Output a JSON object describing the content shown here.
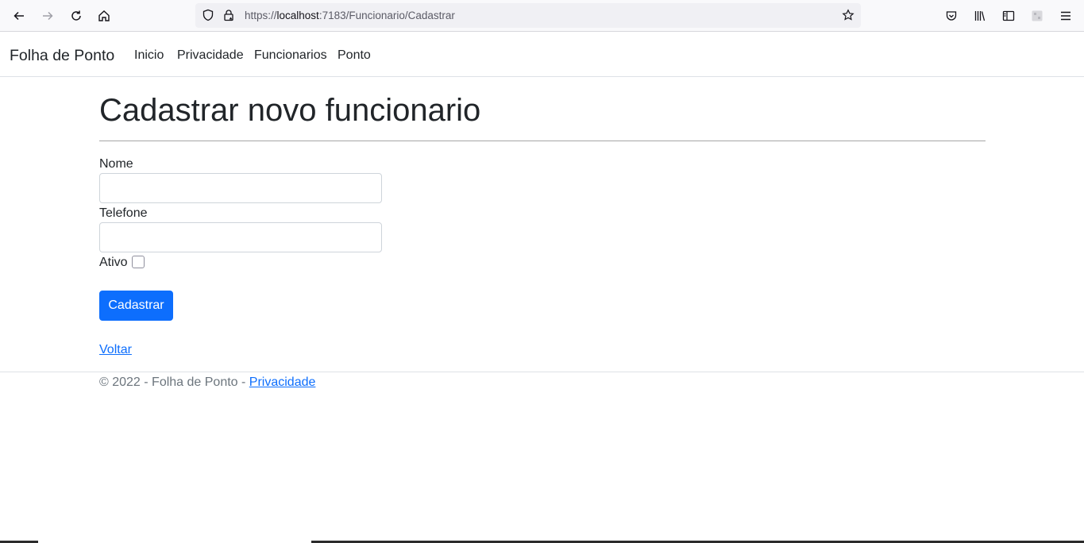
{
  "browser": {
    "url_scheme": "https://",
    "url_host": "localhost",
    "url_path": ":7183/Funcionario/Cadastrar",
    "icons": [
      "back-arrow-icon",
      "forward-arrow-icon",
      "reload-icon",
      "home-icon",
      "shield-icon",
      "lock-icon",
      "star-icon",
      "pocket-icon",
      "library-icon",
      "sidebar-icon",
      "extension-icon",
      "hamburger-menu-icon"
    ]
  },
  "navbar": {
    "brand": "Folha de Ponto",
    "links": [
      "Inicio",
      "Privacidade",
      "Funcionarios",
      "Ponto"
    ]
  },
  "main": {
    "title": "Cadastrar novo funcionario",
    "form": {
      "nome_label": "Nome",
      "nome_value": "",
      "telefone_label": "Telefone",
      "telefone_value": "",
      "ativo_label": "Ativo",
      "ativo_checked": false,
      "submit_label": "Cadastrar"
    },
    "back_link": "Voltar"
  },
  "footer": {
    "text": "© 2022 - Folha de Ponto - ",
    "link": "Privacidade"
  },
  "colors": {
    "primary": "#0d6efd",
    "text": "#212529",
    "muted": "#6c757d",
    "border": "#dee2e6"
  }
}
